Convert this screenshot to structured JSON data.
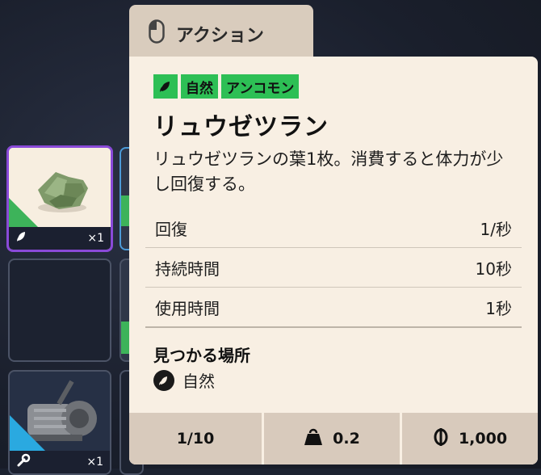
{
  "tab": {
    "label": "アクション",
    "icon": "mouse-icon"
  },
  "inventory": {
    "slot1": {
      "quantity": "×1",
      "category_icon": "leaf-icon",
      "rarity_color": "#8a4ad8"
    },
    "slot3": {
      "quantity": "×1",
      "category_icon": "wrench-icon"
    }
  },
  "item": {
    "tags": [
      "自然",
      "アンコモン"
    ],
    "tag_color": "#2dbf55",
    "name": "リュウゼツラン",
    "description": "リュウゼツランの葉1枚。消費すると体力が少し回復する。",
    "stats": [
      {
        "label": "回復",
        "value": "1/秒"
      },
      {
        "label": "持続時間",
        "value": "10秒"
      },
      {
        "label": "使用時間",
        "value": "1秒"
      }
    ],
    "found_title": "見つかる場所",
    "found_location": "自然"
  },
  "footer": {
    "stack": "1/10",
    "weight": "0.2",
    "value": "1,000"
  }
}
